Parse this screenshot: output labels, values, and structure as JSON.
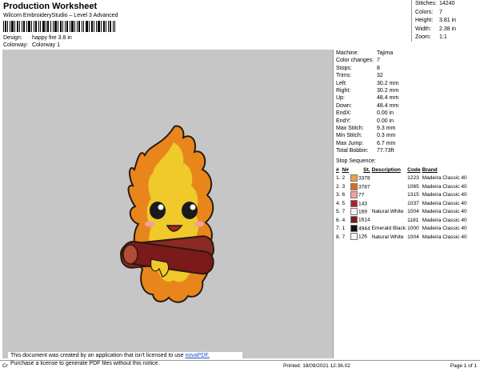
{
  "header": {
    "title": "Production Worksheet",
    "subtitle": "Wilcom EmbroideryStudio – Level 3 Advanced"
  },
  "meta": {
    "design_label": "Design:",
    "design_value": "happy fire 3.8 in",
    "colorway_label": "Colorway:",
    "colorway_value": "Colorway 1"
  },
  "stats": [
    {
      "label": "Stitches:",
      "value": "14240"
    },
    {
      "label": "Colors:",
      "value": "7"
    },
    {
      "label": "Height:",
      "value": "3.81 in"
    },
    {
      "label": "Width:",
      "value": "2.38 in"
    },
    {
      "label": "Zoom:",
      "value": "1:1"
    }
  ],
  "machine": [
    {
      "label": "Machine:",
      "value": "Tajima"
    },
    {
      "label": "Color changes:",
      "value": "7"
    },
    {
      "label": "Stops:",
      "value": "8"
    },
    {
      "label": "Trims:",
      "value": "32"
    },
    {
      "label": "Left:",
      "value": "30.2 mm"
    },
    {
      "label": "Right:",
      "value": "30.2 mm"
    },
    {
      "label": "Up:",
      "value": "48.4 mm"
    },
    {
      "label": "Down:",
      "value": "48.4 mm"
    },
    {
      "label": "EndX:",
      "value": "0.00 in"
    },
    {
      "label": "EndY:",
      "value": "0.00 in"
    },
    {
      "label": "Max Stitch:",
      "value": "9.3 mm"
    },
    {
      "label": "Min Stitch:",
      "value": "0.3 mm"
    },
    {
      "label": "Max Jump:",
      "value": "6.7 mm"
    },
    {
      "label": "Total Bobbin:",
      "value": "77.73ft"
    }
  ],
  "sequence": {
    "title": "Stop Sequence:",
    "headers": [
      "#",
      "N#",
      "St.",
      "Description",
      "Code",
      "Brand"
    ],
    "rows": [
      {
        "stop": "1.",
        "n": "2",
        "color": "#e8a23a",
        "st": "3378",
        "desc": "",
        "code": "1223",
        "brand": "Madeira Classic 40"
      },
      {
        "stop": "2.",
        "n": "3",
        "color": "#e06a1c",
        "st": "3787",
        "desc": "",
        "code": "1065",
        "brand": "Madeira Classic 40"
      },
      {
        "stop": "3.",
        "n": "6",
        "color": "#f0a0a0",
        "st": "77",
        "desc": "",
        "code": "1315",
        "brand": "Madeira Classic 40"
      },
      {
        "stop": "4.",
        "n": "5",
        "color": "#b02020",
        "st": "143",
        "desc": "",
        "code": "1037",
        "brand": "Madeira Classic 40"
      },
      {
        "stop": "5.",
        "n": "7",
        "color": "#f4f4f4",
        "st": "169",
        "desc": "Natural White",
        "code": "1004",
        "brand": "Madeira Classic 40"
      },
      {
        "stop": "6.",
        "n": "4",
        "color": "#7a1a1a",
        "st": "1614",
        "desc": "",
        "code": "1181",
        "brand": "Madeira Classic 40"
      },
      {
        "stop": "7.",
        "n": "1",
        "color": "#111111",
        "st": "4944",
        "desc": "Emerald Black",
        "code": "1000",
        "brand": "Madeira Classic 40"
      },
      {
        "stop": "8.",
        "n": "7",
        "color": "#f4f4f4",
        "st": "126",
        "desc": "Natural White",
        "code": "1004",
        "brand": "Madeira Classic 40"
      }
    ]
  },
  "notice": {
    "line1": "This document was created by an application that isn't licensed to use",
    "link": "novaPDF.",
    "line2": "Purchase a license to generate PDF files without this notice."
  },
  "footer": {
    "left": "Cr",
    "printed": "Printed: 18/09/2021 12:36.02",
    "page": "Page 1 of 1"
  },
  "colors": {
    "canvas_bg": "#c6c6c6",
    "flame_outer": "#e8861c",
    "flame_inner": "#f0c92a",
    "log": "#8a2a22"
  }
}
